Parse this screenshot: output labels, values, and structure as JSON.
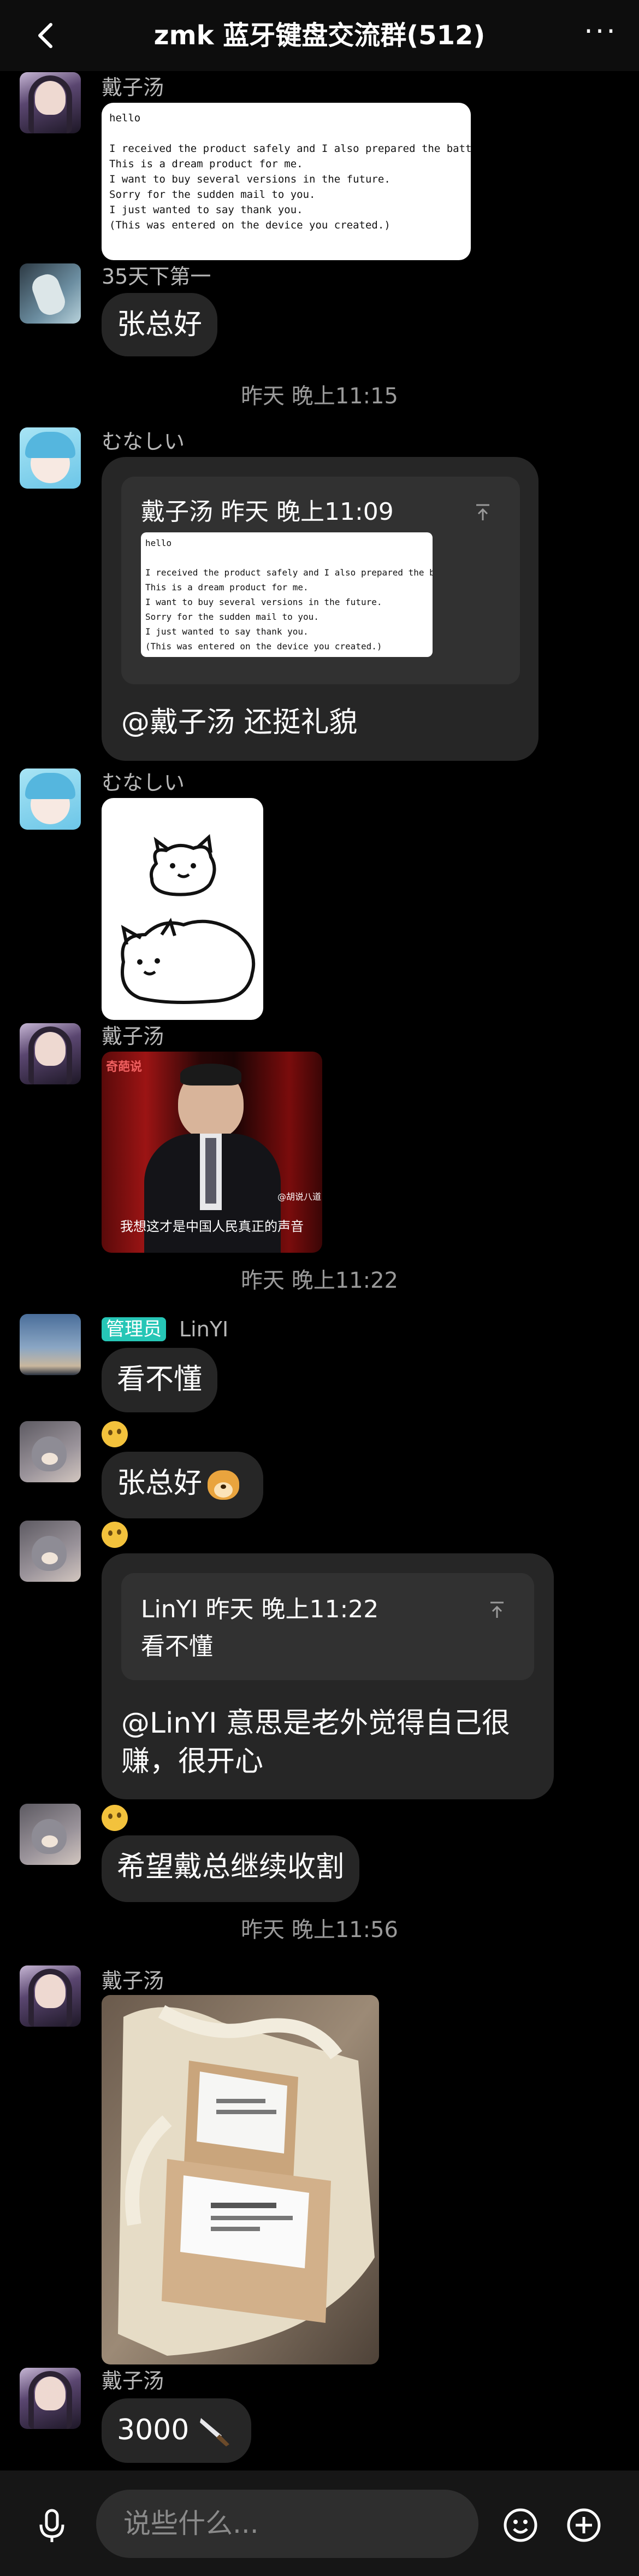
{
  "header": {
    "back_icon": "chevron-left-icon",
    "title": "zmk 蓝牙键盘交流群(512)",
    "more_label": "···"
  },
  "messages": {
    "m1": {
      "sender": "戴子汤",
      "avatar": "avatar-girl-dark-hair",
      "email_lines": [
        "hello",
        "",
        "I received the product safely and I also prepared the battery.",
        "This is a dream product for me.",
        "I want to buy several versions in the future.",
        "Sorry for the sudden mail to you.",
        "I just wanted to say thank you.",
        "(This was entered on the device you created.)"
      ]
    },
    "m2": {
      "sender": "35天下第一",
      "text": "张总好"
    },
    "ts1": "昨天 晚上11:15",
    "m3": {
      "sender": "むなしい",
      "quote_header": "戴子汤 昨天 晚上11:09",
      "reply": "@戴子汤 还挺礼貌"
    },
    "m4": {
      "sender": "むなしい",
      "sticker": "two-cats-doodle-sticker"
    },
    "m5": {
      "sender": "戴子汤",
      "image_caption": "我想这才是中国人民真正的声音",
      "image_logo": "奇葩说",
      "image_corner": "@胡说八道"
    },
    "ts2": "昨天 晚上11:22",
    "m6": {
      "badge": "管理员",
      "sender": "LinYI",
      "text": "看不懂"
    },
    "m7": {
      "reaction": "🤔",
      "text": "张总好",
      "emoji": "dog-face-emoji"
    },
    "m8": {
      "reaction": "🤔",
      "quote_header": "LinYI 昨天 晚上11:22",
      "quote_text": "看不懂",
      "reply_line1": "@LinYI 意思是老外觉得自己很",
      "reply_line2": "赚，很开心"
    },
    "m9": {
      "reaction": "🤔",
      "text": "希望戴总继续收割"
    },
    "ts3": "昨天 晚上11:56",
    "m10": {
      "sender": "戴子汤",
      "photo": "cardboard-boxes-in-bag-photo"
    },
    "m11": {
      "sender": "戴子汤",
      "text": "3000",
      "emoji": "knife-emoji"
    }
  },
  "input_bar": {
    "mic_icon": "microphone-icon",
    "placeholder": "说些什么...",
    "emoji_icon": "smiley-icon",
    "add_icon": "plus-circle-icon"
  },
  "colors": {
    "background": "#000000",
    "bubble": "#262626",
    "quote_card": "#1c1c1c",
    "admin_badge": "#26c6b6"
  }
}
